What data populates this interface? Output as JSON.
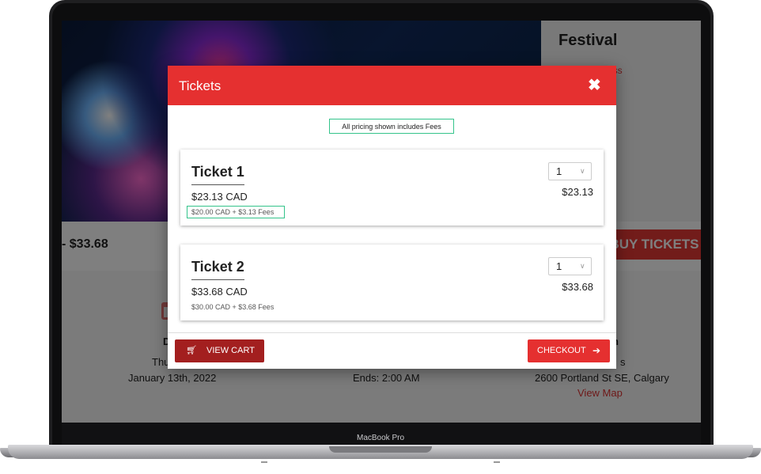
{
  "device": {
    "model_label": "MacBook Pro"
  },
  "background_page": {
    "event_title": "Festival",
    "event_subtitle": "oss",
    "price_range": "- $33.68",
    "buy_button": "BUY TICKETS",
    "date_heading": "D",
    "date_day": "Thu",
    "date_full": "January 13th, 2022",
    "time_end": "Ends: 2:00 AM",
    "location_heading": "n",
    "location_line": "s",
    "location_address": "2600 Portland St SE, Calgary",
    "view_map": "View Map"
  },
  "modal": {
    "title": "Tickets",
    "close_icon": "close-icon",
    "fees_note": "All pricing shown includes Fees",
    "tickets": [
      {
        "name": "Ticket 1",
        "price": "$23.13 CAD",
        "breakdown": "$20.00 CAD + $3.13 Fees",
        "quantity": "1",
        "total": "$23.13"
      },
      {
        "name": "Ticket 2",
        "price": "$33.68 CAD",
        "breakdown": "$30.00 CAD + $3.68 Fees",
        "quantity": "1",
        "total": "$33.68"
      }
    ],
    "view_cart_label": "VIEW CART",
    "checkout_label": "CHECKOUT"
  },
  "colors": {
    "accent": "#e53030",
    "dark_accent": "#a31f1f",
    "highlight_box": "#34c48b"
  }
}
